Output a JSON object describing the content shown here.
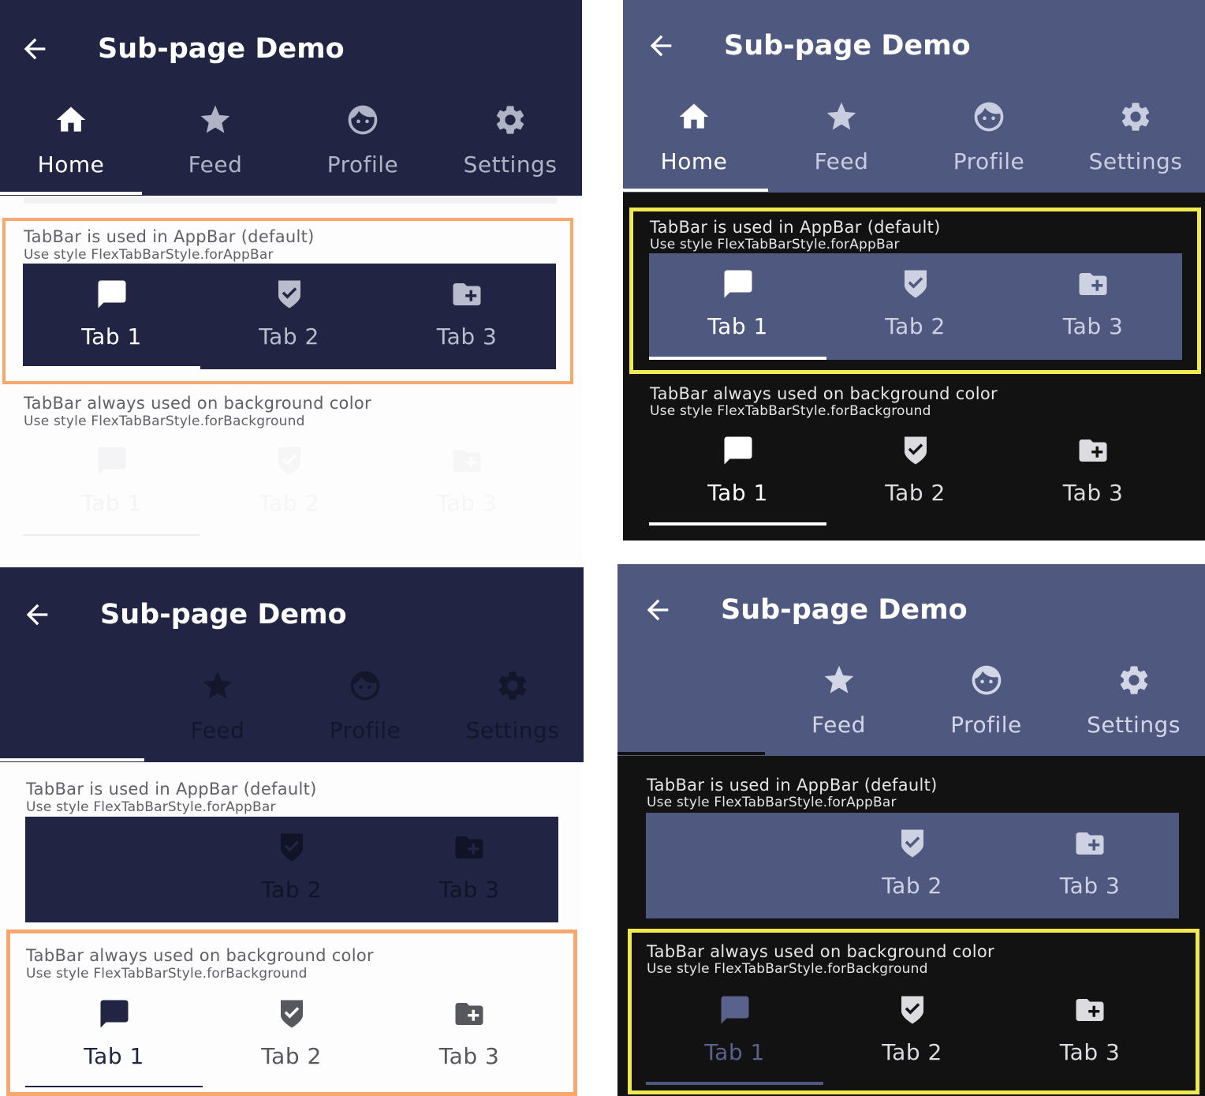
{
  "appbar": {
    "title": "Sub-page Demo",
    "tabs": [
      {
        "label": "Home",
        "icon": "home-icon"
      },
      {
        "label": "Feed",
        "icon": "star-icon"
      },
      {
        "label": "Profile",
        "icon": "face-icon"
      },
      {
        "label": "Settings",
        "icon": "gear-icon"
      }
    ]
  },
  "section_appbar": {
    "title": "TabBar is used in AppBar (default)",
    "subtitle": "Use style FlexTabBarStyle.forAppBar"
  },
  "section_background": {
    "title": "TabBar always used on background color",
    "subtitle": "Use style FlexTabBarStyle.forBackground"
  },
  "inner_tabs": [
    {
      "label": "Tab 1",
      "icon": "chat-icon"
    },
    {
      "label": "Tab 2",
      "icon": "shield-check-icon"
    },
    {
      "label": "Tab 3",
      "icon": "folder-add-icon"
    }
  ],
  "colors": {
    "dark_navy": "#212443",
    "slate_blue": "#4f587f",
    "dark_bg": "#121212",
    "highlight_orange": "#f6a86e",
    "highlight_yellow": "#f2e94e"
  }
}
